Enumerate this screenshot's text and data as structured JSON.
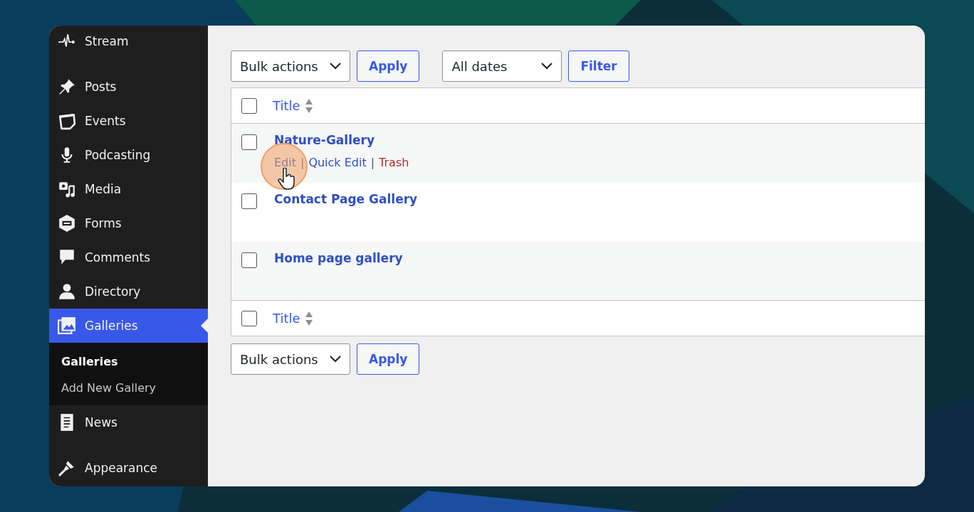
{
  "sidebar": {
    "items": [
      {
        "label": "Stream",
        "selected": false
      },
      {
        "label": "Posts",
        "selected": false
      },
      {
        "label": "Events",
        "selected": false
      },
      {
        "label": "Podcasting",
        "selected": false
      },
      {
        "label": "Media",
        "selected": false
      },
      {
        "label": "Forms",
        "selected": false
      },
      {
        "label": "Comments",
        "selected": false
      },
      {
        "label": "Directory",
        "selected": false
      },
      {
        "label": "Galleries",
        "selected": true,
        "children": [
          {
            "label": "Galleries",
            "selected": true
          },
          {
            "label": "Add New Gallery",
            "selected": false
          }
        ]
      },
      {
        "label": "News",
        "selected": false
      },
      {
        "label": "Appearance",
        "selected": false
      }
    ]
  },
  "top_toolbar": {
    "bulk_select": "Bulk actions",
    "apply": "Apply",
    "date_select": "All dates",
    "filter": "Filter"
  },
  "table": {
    "header": {
      "checked": false,
      "column": "Title"
    },
    "rows": [
      {
        "checked": false,
        "title": "Nature-Gallery",
        "actions": [
          {
            "label": "Edit",
            "kind": "link"
          },
          {
            "label": "Quick Edit",
            "kind": "link"
          },
          {
            "label": "Trash",
            "kind": "delete"
          }
        ],
        "separator": "|"
      },
      {
        "checked": false,
        "title": "Contact Page Gallery"
      },
      {
        "checked": false,
        "title": "Home page gallery"
      }
    ],
    "footer": {
      "checked": false,
      "column": "Title"
    }
  },
  "bottom_toolbar": {
    "bulk_select": "Bulk actions",
    "apply": "Apply"
  }
}
